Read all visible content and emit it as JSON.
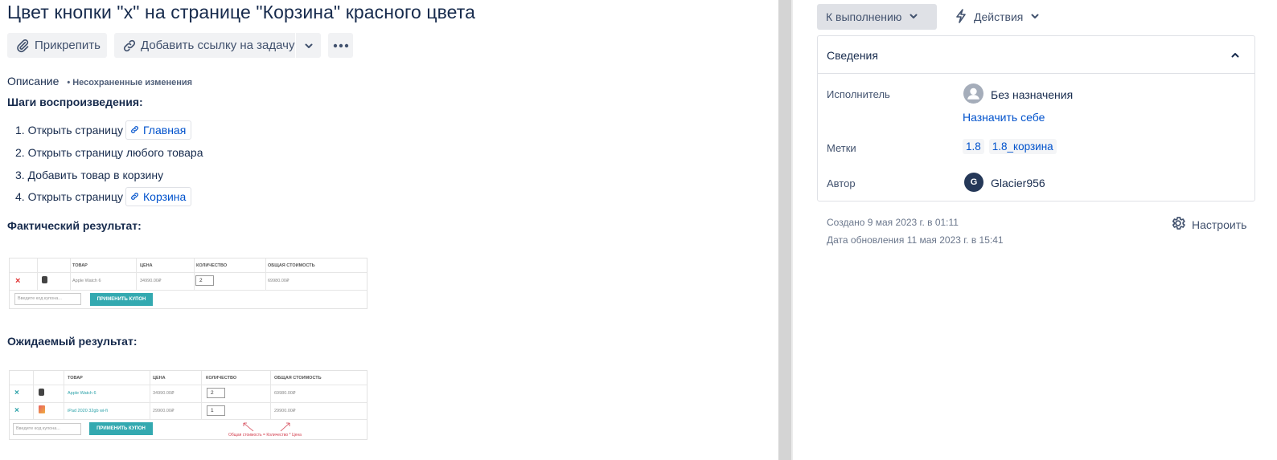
{
  "issue": {
    "title": "Цвет кнопки \"х\" на странице \"Корзина\" красного цвета",
    "toolbar": {
      "attach_label": "Прикрепить",
      "add_link_label": "Добавить ссылку на задачу"
    },
    "description": {
      "label": "Описание",
      "unsaved_note": "Несохраненные изменения",
      "steps_heading": "Шаги воспроизведения:",
      "steps": [
        {
          "text": "1. Открыть страницу",
          "link": "Главная"
        },
        {
          "text": "2. Открыть страницу любого товара",
          "link": ""
        },
        {
          "text": "3. Добавить товар в корзину",
          "link": ""
        },
        {
          "text": "4. Открыть страницу",
          "link": "Корзина"
        }
      ],
      "actual_heading": "Фактический результат:",
      "expected_heading": "Ожидаемый результат:"
    },
    "actual_table": {
      "headers": [
        "ТОВАР",
        "ЦЕНА",
        "КОЛИЧЕСТВО",
        "ОБЩАЯ СТОИМОСТЬ"
      ],
      "rows": [
        {
          "remove": "×",
          "product": "Apple Watch 6",
          "price": "34990.00₽",
          "qty": "2",
          "total": "69980.00₽"
        }
      ],
      "coupon_placeholder": "Введите код купона...",
      "apply_label": "ПРИМЕНИТЬ КУПОН",
      "remove_color": "#e03030"
    },
    "expected_table": {
      "headers": [
        "ТОВАР",
        "ЦЕНА",
        "КОЛИЧЕСТВО",
        "ОБЩАЯ СТОИМОСТЬ"
      ],
      "rows": [
        {
          "remove": "×",
          "product": "Apple Watch 6",
          "price": "34990.00₽",
          "qty": "2",
          "total": "69980.00₽"
        },
        {
          "remove": "×",
          "product": "iPad 2020 32gb wi-fi",
          "price": "29900.00₽",
          "qty": "1",
          "total": "29900.00₽"
        }
      ],
      "coupon_placeholder": "Введите код купона...",
      "apply_label": "ПРИМЕНИТЬ КУПОН",
      "annotation": "Общая стоимость = Количество * Цена",
      "remove_color": "#2aa1a8",
      "annotation_color": "#d23c4c"
    }
  },
  "sidebar": {
    "status_label": "К выполнению",
    "actions_label": "Действия",
    "details": {
      "heading": "Сведения",
      "assignee_label": "Исполнитель",
      "assignee_value": "Без назначения",
      "assign_self": "Назначить себе",
      "labels_label": "Метки",
      "labels": [
        "1.8",
        "1.8_корзина"
      ],
      "author_label": "Автор",
      "author_initial": "G",
      "author_name": "Glacier956"
    },
    "created": "Создано 9 мая 2023 г. в 01:11",
    "updated": "Дата обновления 11 мая 2023 г. в 15:41",
    "configure_label": "Настроить"
  },
  "colors": {
    "text": "#172b4d",
    "link": "#0052cc",
    "muted": "#6b778c",
    "button_bg": "#f1f2f4",
    "author_avatar": "#253858"
  }
}
